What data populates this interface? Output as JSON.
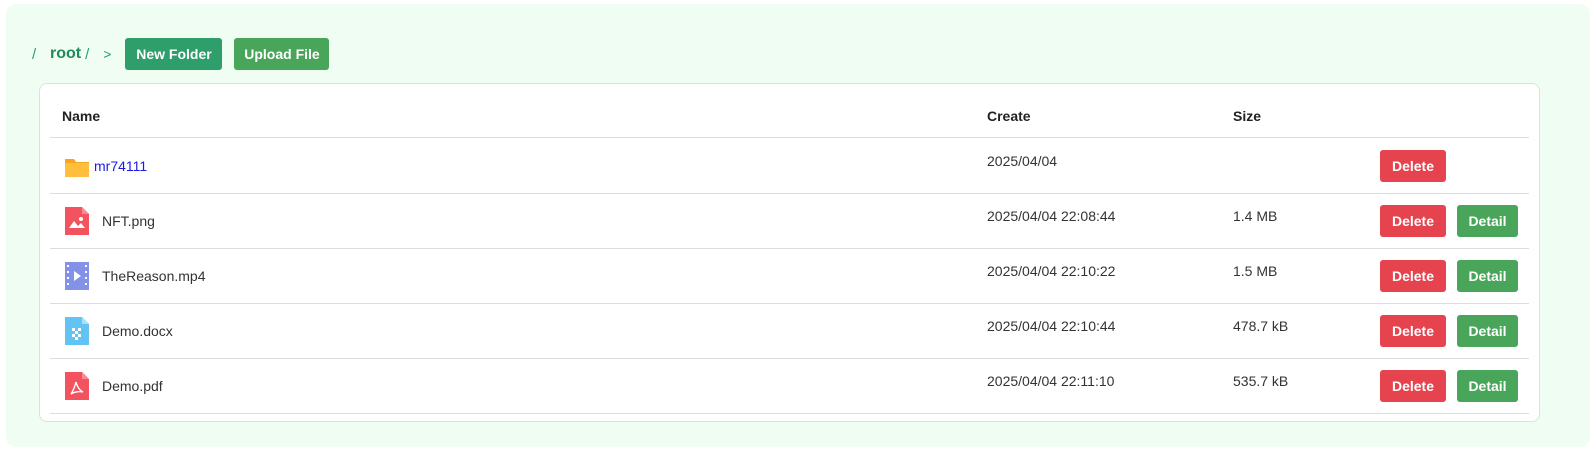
{
  "breadcrumb": {
    "separator": "/",
    "root_label": "root",
    "trailing_separator": "/",
    "arrow": ">"
  },
  "toolbar": {
    "new_folder_label": "New Folder",
    "upload_file_label": "Upload File"
  },
  "table": {
    "columns": {
      "name": "Name",
      "create": "Create",
      "size": "Size"
    },
    "rows": [
      {
        "type": "folder",
        "name": "mr74111",
        "create": "2025/04/04",
        "size": "",
        "delete_label": "Delete",
        "icon": "folder-icon"
      },
      {
        "type": "image",
        "name": "NFT.png",
        "create": "2025/04/04 22:08:44",
        "size": "1.4 MB",
        "delete_label": "Delete",
        "detail_label": "Detail",
        "icon": "image-file-icon"
      },
      {
        "type": "video",
        "name": "TheReason.mp4",
        "create": "2025/04/04 22:10:22",
        "size": "1.5 MB",
        "delete_label": "Delete",
        "detail_label": "Detail",
        "icon": "video-file-icon"
      },
      {
        "type": "doc",
        "name": "Demo.docx",
        "create": "2025/04/04 22:10:44",
        "size": "478.7 kB",
        "delete_label": "Delete",
        "detail_label": "Detail",
        "icon": "docx-file-icon"
      },
      {
        "type": "pdf",
        "name": "Demo.pdf",
        "create": "2025/04/04 22:11:10",
        "size": "535.7 kB",
        "delete_label": "Delete",
        "detail_label": "Detail",
        "icon": "pdf-file-icon"
      }
    ]
  },
  "colors": {
    "panel_background": "#f0fdf3",
    "primary_green": "#2e9e6b",
    "button_green": "#49a55a",
    "danger_red": "#e5444f",
    "folder_link": "#1a1ae6"
  }
}
